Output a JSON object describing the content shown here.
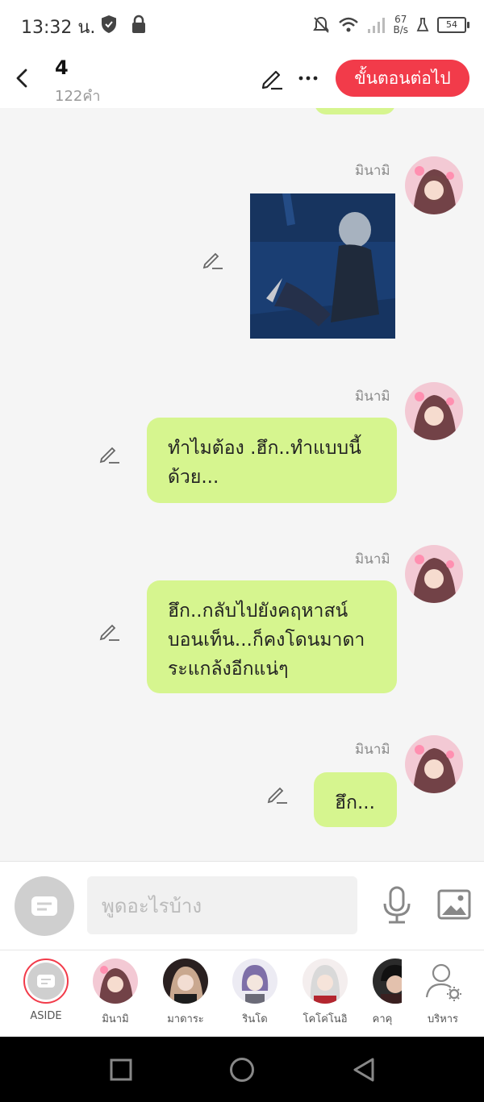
{
  "status_bar": {
    "time": "13:32 น.",
    "speed_value": "67",
    "speed_unit": "B/s",
    "battery": "54"
  },
  "header": {
    "chapter_number": "4",
    "word_count": "122คำ",
    "next_button": "ขั้นตอนต่อไป"
  },
  "messages": [
    {
      "sender": "มินามิ",
      "type": "image"
    },
    {
      "sender": "มินามิ",
      "type": "text",
      "text": "ทำไมต้อง .ฮึก..ทำแบบนี้ด้วย..."
    },
    {
      "sender": "มินามิ",
      "type": "text",
      "text": "ฮึก..กลับไปยังคฤหาสน์บอนเท็น...ก็คงโดนมาดาระแกล้งอีกแน่ๆ"
    },
    {
      "sender": "มินามิ",
      "type": "text",
      "text": "ฮึก..."
    }
  ],
  "input": {
    "placeholder": "พูดอะไรบ้าง"
  },
  "characters": [
    {
      "name": "ASIDE"
    },
    {
      "name": "มินามิ"
    },
    {
      "name": "มาดาระ"
    },
    {
      "name": "รินโด"
    },
    {
      "name": "โคโค่โนอิ"
    },
    {
      "name": "คาคุ"
    },
    {
      "name": "บริหาร"
    }
  ],
  "colors": {
    "accent": "#f23b4a",
    "bubble": "#d6f58f"
  },
  "icons": [
    "back-icon",
    "edit-icon",
    "more-icon",
    "pencil-icon",
    "mic-icon",
    "image-icon",
    "aside-icon",
    "manage-characters-icon",
    "nav-square-icon",
    "nav-circle-icon",
    "nav-triangle-icon"
  ]
}
